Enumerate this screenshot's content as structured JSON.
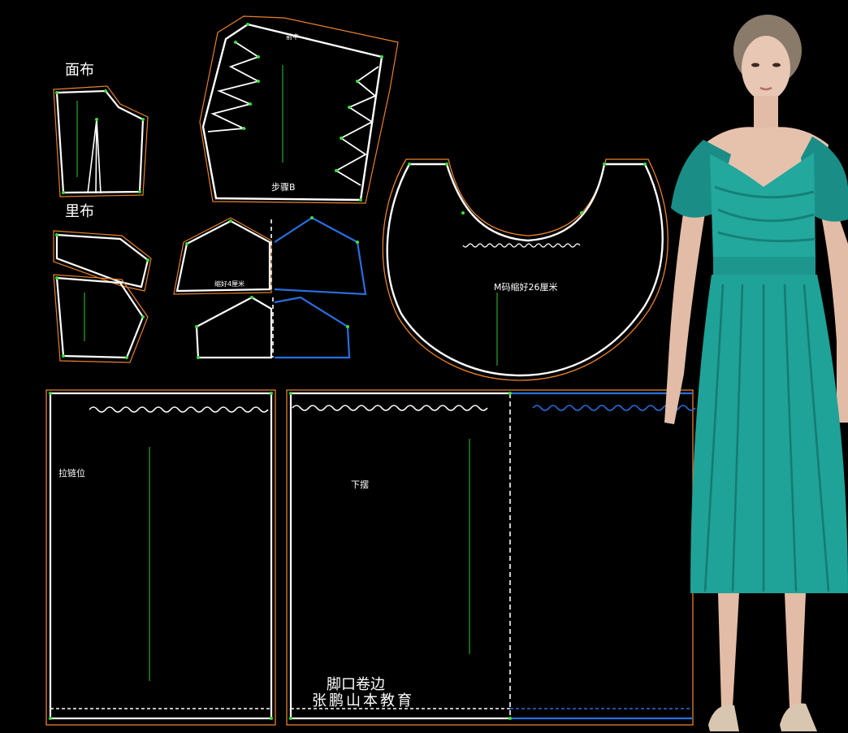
{
  "labels": {
    "face_fabric": "面布",
    "lining": "里布",
    "front_center": "前中",
    "bodice_b": "步骤B",
    "gather_note": "M码缩好26厘米",
    "zipper_position": "拉链位",
    "hem_label": "下摆",
    "hem_roll": "脚口卷边",
    "brand": "张鹏山本教育"
  },
  "colors": {
    "background": "#000000",
    "pattern_line": "#ffffff",
    "seam_allowance": "#e8822a",
    "mirror_piece": "#2a6fe0",
    "grainline": "#34c934",
    "notch": "#39e039",
    "dress": "#1e9e95"
  },
  "figure": {
    "description_icon": "3d-avatar-teal-dress"
  }
}
